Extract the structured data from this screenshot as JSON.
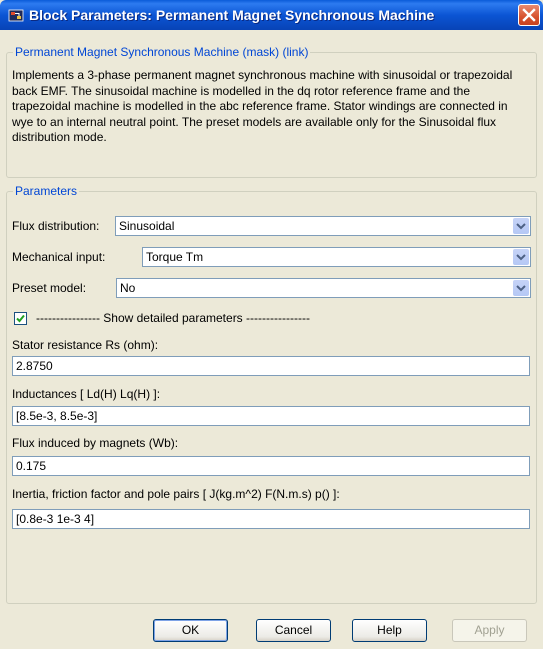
{
  "window": {
    "title": "Block Parameters: Permanent Magnet Synchronous Machine",
    "icons": {
      "app": "simulink-block-icon",
      "close": "close-icon"
    }
  },
  "mask_group": {
    "legend": "Permanent Magnet Synchronous Machine (mask) (link)",
    "description": "Implements a 3-phase permanent magnet synchronous machine with sinusoidal or trapezoidal back EMF. The sinusoidal machine is modelled in the dq rotor reference frame and the trapezoidal machine is modelled in the abc reference frame. Stator windings are connected in wye to an internal neutral point. The preset models are available only for the Sinusoidal flux distribution mode."
  },
  "parameters": {
    "legend": "Parameters",
    "flux_distribution": {
      "label": "Flux distribution:",
      "value": "Sinusoidal"
    },
    "mechanical_input": {
      "label": "Mechanical input:",
      "value": "Torque Tm"
    },
    "preset_model": {
      "label": "Preset model:",
      "value": "No"
    },
    "show_detailed": {
      "label": "---------------- Show detailed parameters ----------------",
      "checked": true
    },
    "stator_resistance": {
      "label": "Stator resistance Rs (ohm):",
      "value": "2.8750"
    },
    "inductances": {
      "label": "Inductances [ Ld(H) Lq(H) ]:",
      "value": "[8.5e-3, 8.5e-3]"
    },
    "flux_magnets": {
      "label": "Flux induced by magnets (Wb):",
      "value": "0.175"
    },
    "inertia": {
      "label": "Inertia, friction factor and pole pairs [ J(kg.m^2) F(N.m.s) p() ]:",
      "value": "[0.8e-3 1e-3 4]"
    }
  },
  "buttons": {
    "ok": "OK",
    "cancel": "Cancel",
    "help": "Help",
    "apply": "Apply"
  },
  "colors": {
    "titlebar": "#0a5bd9",
    "dialog_bg": "#ece9d8",
    "legend_text": "#0046d5",
    "checkmark": "#21a121"
  }
}
